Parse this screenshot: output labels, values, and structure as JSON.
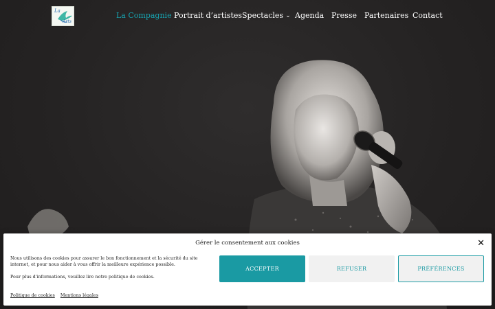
{
  "header": {
    "logo_text_top": "La",
    "logo_text_bottom": "Arts",
    "nav": [
      {
        "label": "La Compagnie",
        "active": true
      },
      {
        "label": "Portrait d’artistes",
        "active": false
      },
      {
        "label": "Spectacles",
        "active": false,
        "has_dropdown": true
      },
      {
        "label": "Agenda",
        "active": false
      },
      {
        "label": "Presse",
        "active": false
      },
      {
        "label": "Partenaires",
        "active": false
      },
      {
        "label": "Contact",
        "active": false
      }
    ],
    "dropdown_icon": "chevron-down-icon",
    "accent_color": "#17a3b0"
  },
  "hero": {
    "image_description_icon": "singer-photo"
  },
  "cookie_banner": {
    "title": "Gérer le consentement aux cookies",
    "close_icon": "close-icon",
    "text_1": "Nous utilisons des cookies pour assurer le bon fonctionnement et la sécurité du site internet, et pour nous aider à vous offrir la meilleure expérience possible.",
    "text_2": "Pour plus d'informations, veuillez lire notre politique de cookies.",
    "accept_label": "ACCEPTER",
    "refuse_label": "REFUSER",
    "preferences_label": "PRÉFÉRENCES",
    "links": [
      "Politique de cookies",
      "Mentions légales"
    ],
    "button_color": "#1a9aa3"
  }
}
